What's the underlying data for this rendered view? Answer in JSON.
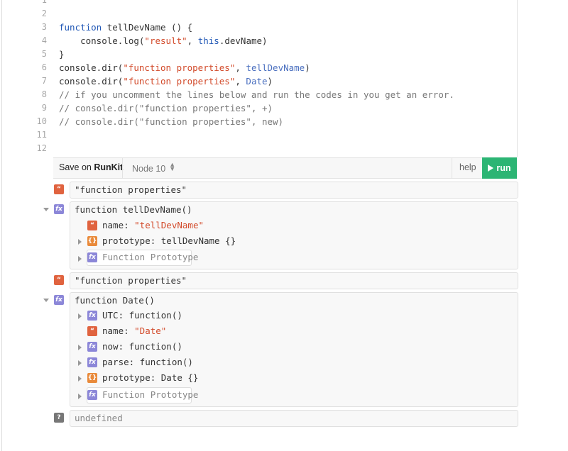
{
  "editor": {
    "line_numbers": [
      "1",
      "2",
      "3",
      "4",
      "5",
      "6",
      "7",
      "8",
      "9",
      "10",
      "11",
      "12"
    ],
    "lines": [
      {
        "t": ""
      },
      {
        "t": ""
      },
      {
        "a": "function",
        "b": " tellDevName () {"
      },
      {
        "a": "    console.log(",
        "s": "\"result\"",
        "c": ", ",
        "k": "this",
        "d": ".devName)"
      },
      {
        "t": "}"
      },
      {
        "a": "console.dir(",
        "s": "\"function properties\"",
        "c": ", ",
        "k": "tellDevName",
        "d": ")"
      },
      {
        "a": "console.dir(",
        "s": "\"function properties\"",
        "c": ", ",
        "k": "Date",
        "d": ")"
      },
      {
        "cm": "// if you uncomment the lines below and run the codes in you get an error."
      },
      {
        "cm": "// console.dir(\"function properties\", +)"
      },
      {
        "cm": "// console.dir(\"function properties\", new)"
      },
      {
        "t": ""
      },
      {
        "t": ""
      }
    ]
  },
  "toolbar": {
    "save_prefix": "Save on ",
    "save_brand": "RunKit",
    "node_version": "Node 10",
    "help": "help",
    "run": "run"
  },
  "output": {
    "str1": "\"function properties\"",
    "fn1_sig": "function tellDevName()",
    "fn1_name": "name: ",
    "fn1_name_val": "\"tellDevName\"",
    "fn1_proto": "prototype: tellDevName {}",
    "fn_proto_label": "Function Prototype",
    "str2": "\"function properties\"",
    "fn2_sig": "function Date()",
    "fn2_utc": "UTC: function()",
    "fn2_name": "name: ",
    "fn2_name_val": "\"Date\"",
    "fn2_now": "now: function()",
    "fn2_parse": "parse: function()",
    "fn2_proto": "prototype: Date {}",
    "undefined": "undefined"
  },
  "icons": {
    "string_badge": "“",
    "function_badge": "fx",
    "object_badge": "{}",
    "unknown_badge": "?"
  },
  "colors": {
    "run_button": "#2cb574",
    "string_badge": "#e0633f",
    "function_badge": "#8c87d8",
    "object_badge": "#e98a3b",
    "keyword": "#1f56b5",
    "string": "#d24a2a"
  }
}
